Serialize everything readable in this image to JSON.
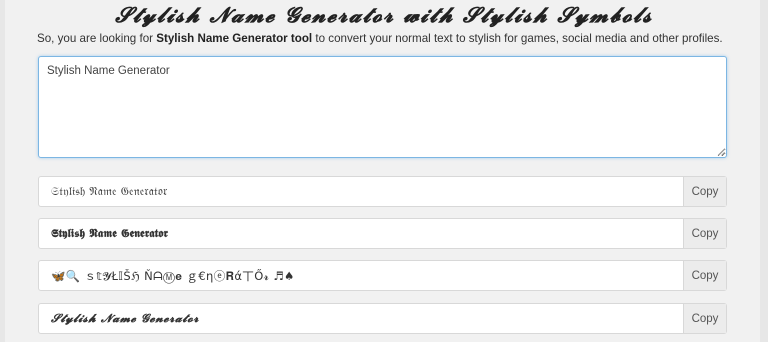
{
  "header": {
    "title": "𝓢𝓽𝔂𝓵𝓲𝓼𝓱 𝓝𝓪𝓶𝓮 𝓖𝓮𝓷𝓮𝓻𝓪𝓽𝓸𝓻 𝔀𝓲𝓽𝓱 𝓢𝓽𝔂𝓵𝓲𝓼𝓱 𝓢𝔂𝓶𝓫𝓸𝓵𝓼"
  },
  "intro": {
    "prefix": "So, you are looking for ",
    "bold": "Stylish Name Generator tool",
    "suffix": " to convert your normal text to stylish for games, social media and other profiles."
  },
  "input": {
    "value": "Stylish Name Generator"
  },
  "results": [
    {
      "text": "𝔖𝔱𝔶𝔩𝔦𝔰𝔥 𝔑𝔞𝔪𝔢 𝔊𝔢𝔫𝔢𝔯𝔞𝔱𝔬𝔯",
      "copy_label": "Copy"
    },
    {
      "text": "𝕾𝖙𝖞𝖑𝖎𝖘𝖍 𝕹𝖆𝖒𝖊 𝕲𝖊𝖓𝖊𝖗𝖆𝖙𝖔𝖗",
      "copy_label": "Copy"
    },
    {
      "text": "🦋🔍  ｓ𝕥𝓨Ł𝕀Šℌ ŇᗩⓂ𝐞 ｇ€ηⓔ𝐑ά丅Ő𝓻  ♬♠",
      "copy_label": "Copy"
    },
    {
      "text": "𝓢𝓽𝔂𝓵𝓲𝓼𝓱 𝓝𝓪𝓶𝓮 𝓖𝓮𝓷𝓮𝓻𝓪𝓽𝓸𝓻",
      "copy_label": "Copy"
    }
  ]
}
